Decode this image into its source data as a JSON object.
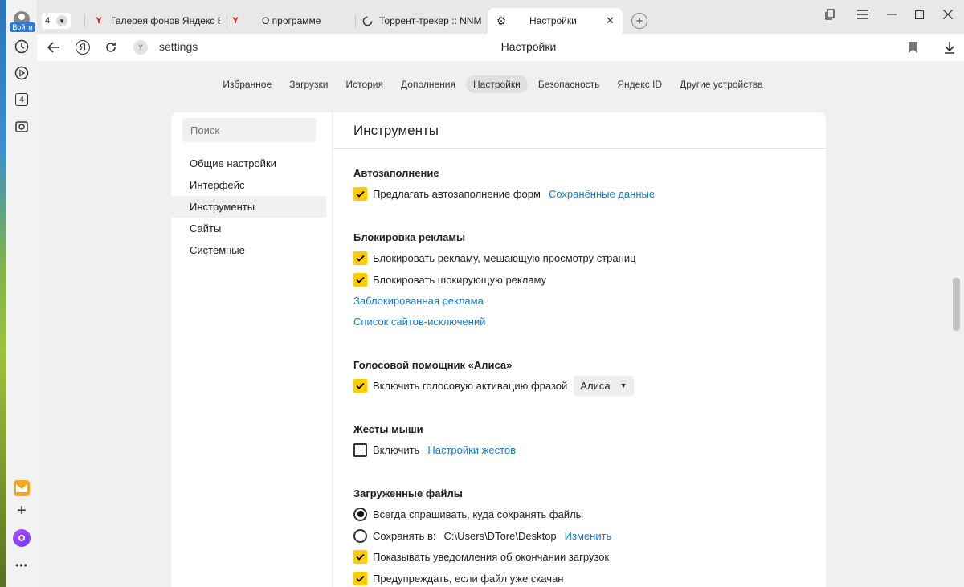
{
  "sidebar": {
    "login_label": "Войти",
    "tab_count": "4"
  },
  "tabs": {
    "count": "4",
    "items": [
      {
        "title": "Галерея фонов Яндекс Бр",
        "icon": "yandex-y-icon"
      },
      {
        "title": "О программе",
        "icon": "yandex-y-icon"
      },
      {
        "title": "Торрент-трекер :: NNM-C",
        "icon": "loading-icon"
      },
      {
        "title": "Настройки",
        "icon": "gear-icon"
      }
    ]
  },
  "toolbar": {
    "address": "settings",
    "page_title": "Настройки"
  },
  "nav": {
    "items": [
      "Избранное",
      "Загрузки",
      "История",
      "Дополнения",
      "Настройки",
      "Безопасность",
      "Яндекс ID",
      "Другие устройства"
    ],
    "active_index": 4
  },
  "left_menu": {
    "search_placeholder": "Поиск",
    "items": [
      "Общие настройки",
      "Интерфейс",
      "Инструменты",
      "Сайты",
      "Системные"
    ],
    "active_index": 2
  },
  "section": {
    "title": "Инструменты",
    "autofill": {
      "heading": "Автозаполнение",
      "offer_label": "Предлагать автозаполнение форм",
      "saved_link": "Сохранённые данные"
    },
    "adblock": {
      "heading": "Блокировка рекламы",
      "block_interfering": "Блокировать рекламу, мешающую просмотру страниц",
      "block_shocking": "Блокировать шокирующую рекламу",
      "blocked_link": "Заблокированная реклама",
      "exceptions_link": "Список сайтов-исключений"
    },
    "alice": {
      "heading": "Голосовой помощник «Алиса»",
      "voice_activation": "Включить голосовую активацию фразой",
      "phrase": "Алиса"
    },
    "gestures": {
      "heading": "Жесты мыши",
      "enable": "Включить",
      "settings_link": "Настройки жестов"
    },
    "downloads": {
      "heading": "Загруженные файлы",
      "always_ask": "Всегда спрашивать, куда сохранять файлы",
      "save_to": "Сохранять в:",
      "path": "C:\\Users\\DTore\\Desktop",
      "change_link": "Изменить",
      "notify": "Показывать уведомления об окончании загрузок",
      "warn_exists": "Предупреждать, если файл уже скачан"
    }
  },
  "colors": {
    "accent_yellow": "#ffcc00",
    "link_blue": "#1a7bc1"
  }
}
